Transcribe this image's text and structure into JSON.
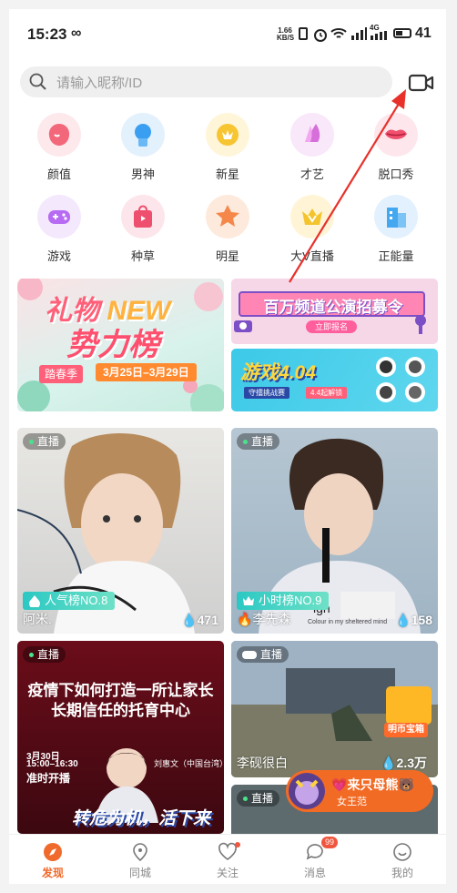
{
  "status_bar": {
    "time": "15:23",
    "loop_glyph": "∞",
    "net_speed_value": "1.66",
    "net_speed_unit": "KB/S",
    "network": "4G",
    "battery": "41"
  },
  "search": {
    "placeholder": "请输入昵称/ID"
  },
  "categories": [
    {
      "label": "颜值",
      "icon": "face-icon",
      "color": "#f3677a"
    },
    {
      "label": "男神",
      "icon": "male-head-icon",
      "color": "#3a9ff0"
    },
    {
      "label": "新星",
      "icon": "crown-star-icon",
      "color": "#f7c532"
    },
    {
      "label": "才艺",
      "icon": "fan-icon",
      "color": "#d66fd9"
    },
    {
      "label": "脱口秀",
      "icon": "lips-icon",
      "color": "#f0506e"
    },
    {
      "label": "游戏",
      "icon": "gamepad-icon",
      "color": "#b66bf2"
    },
    {
      "label": "种草",
      "icon": "shopping-bag-icon",
      "color": "#ee4f6e"
    },
    {
      "label": "明星",
      "icon": "star-icon",
      "color": "#f5874a"
    },
    {
      "label": "大V直播",
      "icon": "v-crown-icon",
      "color": "#f4c42e"
    },
    {
      "label": "正能量",
      "icon": "building-icon",
      "color": "#44a8f1"
    }
  ],
  "banners": {
    "gift": {
      "title_cn": "礼物",
      "title_en": "NEW",
      "subtitle": "势力榜",
      "season": "踏春季",
      "dates": "3月25日–3月29日"
    },
    "recruit": {
      "title": "百万频道公演招募令",
      "button": "立即报名"
    },
    "game": {
      "title": "游戏4.04",
      "sub1": "守擂挑战赛",
      "sub2": "4.4起解锁"
    }
  },
  "cards": [
    {
      "live": "直播",
      "rank": "人气榜NO.8",
      "name": "阿米.",
      "heat": "471"
    },
    {
      "live": "直播",
      "rank": "小时榜NO.9",
      "name": "李先森",
      "heat": "158",
      "overlay_text1": "ign",
      "overlay_text2": "Colour in my sheltered mind"
    },
    {
      "live": "直播",
      "headline1": "疫情下如何打造一所让家长",
      "headline2": "长期信任的托育中心",
      "date": "3月30日",
      "time": "15:00–16:30",
      "on_time": "准时开播",
      "speaker": "刘惠文（中国台湾）",
      "slogan1": "转危为机，",
      "slogan2": "活下来"
    },
    {
      "live": "直播",
      "name": "李砚很白",
      "heat": "2.3万",
      "chest": "明币宝箱"
    },
    {
      "live": "直播"
    }
  ],
  "floating_promo": {
    "title": "来只母熊",
    "subtitle": "女王范"
  },
  "nav": [
    {
      "label": "发现",
      "active": true
    },
    {
      "label": "同城"
    },
    {
      "label": "关注"
    },
    {
      "label": "消息",
      "badge": "99"
    },
    {
      "label": "我的"
    }
  ],
  "colors": {
    "accent": "#f06a2c",
    "nav_active": "#f06a2c"
  }
}
